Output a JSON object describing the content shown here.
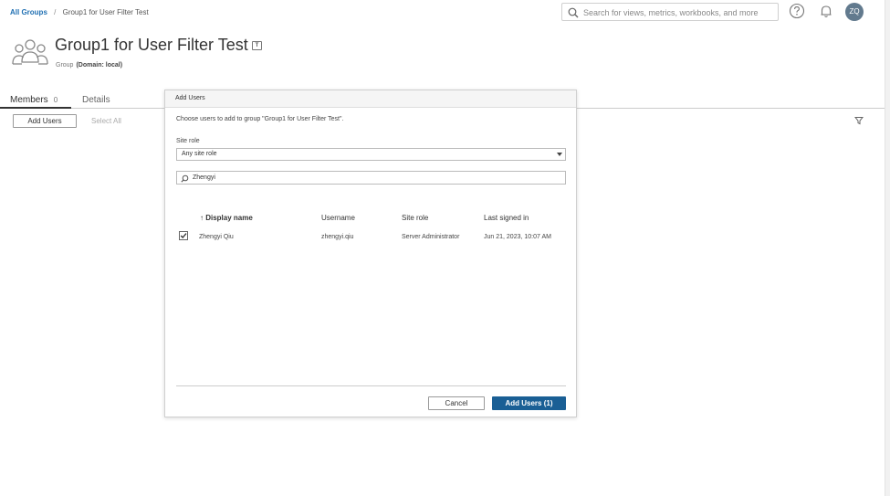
{
  "breadcrumb": {
    "root": "All Groups",
    "separator": "/",
    "current": "Group1 for User Filter Test"
  },
  "search": {
    "placeholder": "Search for views, metrics, workbooks, and more"
  },
  "user": {
    "initials": "ZQ"
  },
  "group": {
    "title": "Group1 for User Filter Test",
    "type": "Group",
    "domain": "(Domain: local)",
    "tag_label": "T"
  },
  "tabs": [
    {
      "label": "Members",
      "count": "0"
    },
    {
      "label": "Details"
    }
  ],
  "actions": {
    "add_users": "Add Users",
    "select_all": "Select All"
  },
  "dialog": {
    "title": "Add Users",
    "description": "Choose users to add to group \"Group1 for User Filter Test\".",
    "site_role_label": "Site role",
    "site_role_value": "Any site role",
    "filter_value": "Zhengyi",
    "columns": [
      "↑ Display name",
      "Username",
      "Site role",
      "Last signed in"
    ],
    "rows": [
      {
        "checked": true,
        "display_name": "Zhengyi Qiu",
        "username": "zhengyi.qiu",
        "site_role": "Server Administrator",
        "last_signed_in": "Jun 21, 2023, 10:07 AM"
      }
    ],
    "cancel_label": "Cancel",
    "confirm_label": "Add Users (1)"
  },
  "colors": {
    "accent": "#1a5f95",
    "link": "#1f6fb2",
    "avatar": "#627a8e"
  }
}
